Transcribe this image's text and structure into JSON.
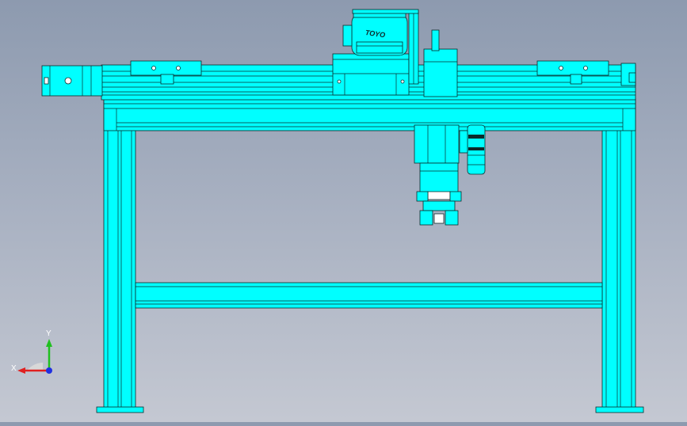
{
  "view": {
    "background_top": "#8d9aaf",
    "background_bottom": "#c4c8d2",
    "model_color": "#00ffff",
    "edge_color": "#0b2b2b"
  },
  "model": {
    "motor_brand": "TOYO"
  },
  "triad": {
    "x_label": "X",
    "y_label": "Y",
    "x_color": "#e02020",
    "y_color": "#20c020",
    "z_color": "#2030e0",
    "icons": [
      "reference-triad-icon"
    ]
  }
}
